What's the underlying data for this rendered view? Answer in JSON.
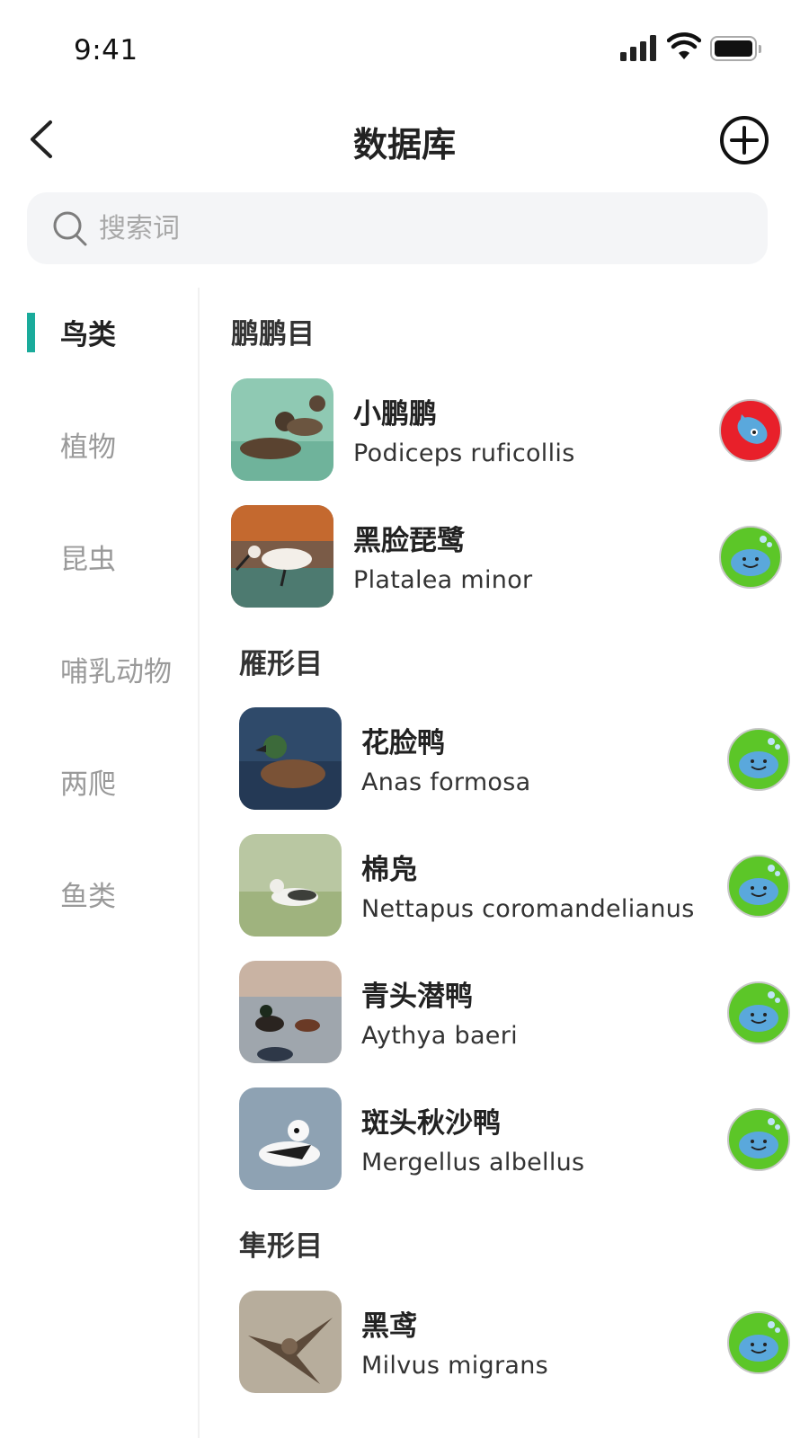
{
  "status_bar": {
    "time": "9:41"
  },
  "header": {
    "title": "数据库"
  },
  "search": {
    "placeholder": "搜索词"
  },
  "categories": [
    {
      "label": "鸟类",
      "active": true
    },
    {
      "label": "植物"
    },
    {
      "label": "昆虫"
    },
    {
      "label": "哺乳动物"
    },
    {
      "label": "两爬"
    },
    {
      "label": "鱼类"
    }
  ],
  "groups": [
    {
      "title": "鹏鹏目",
      "species": [
        {
          "name": "小鹏鹏",
          "latin": "Podiceps ruficollis",
          "badge": "red"
        },
        {
          "name": "黑脸琵鹭",
          "latin": "Platalea minor",
          "badge": "green"
        }
      ]
    },
    {
      "title": "雁形目",
      "species": [
        {
          "name": "花脸鸭",
          "latin": "Anas formosa",
          "badge": "green"
        },
        {
          "name": "棉凫",
          "latin": "Nettapus coromandelianus",
          "badge": "green"
        },
        {
          "name": "青头潜鸭",
          "latin": "Aythya baeri",
          "badge": "green"
        },
        {
          "name": "斑头秋沙鸭",
          "latin": "Mergellus albellus",
          "badge": "green"
        }
      ]
    },
    {
      "title": "隼形目",
      "species": [
        {
          "name": "黑鸢",
          "latin": "Milvus migrans",
          "badge": "green"
        }
      ]
    }
  ],
  "colors": {
    "accent": "#1aab9b",
    "badge_red": "#e8202a",
    "badge_green": "#5cc628",
    "dolphin_blue": "#5aa8dc"
  }
}
